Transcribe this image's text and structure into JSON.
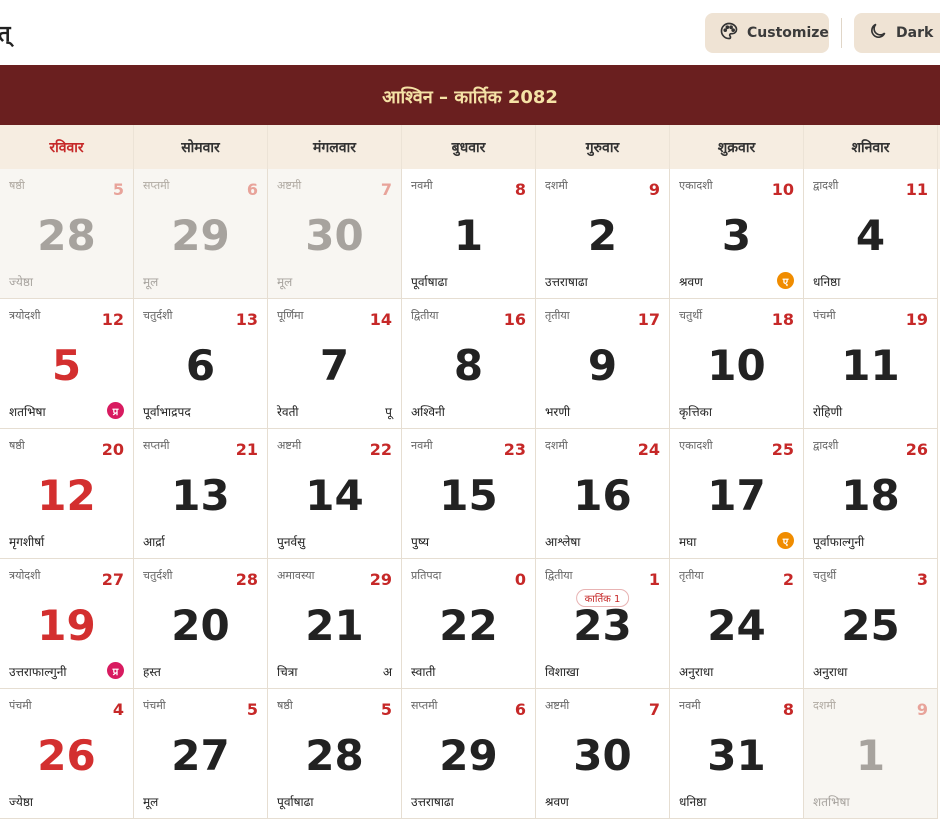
{
  "header": {
    "left_title_fragment": "त्",
    "customize_label": "Customize",
    "dark_label": "Dark",
    "customize_icon": "palette-icon",
    "dark_icon": "moon-icon"
  },
  "banner": {
    "month": "आश्विन – कार्तिक 2082"
  },
  "weekdays": [
    "रविवार",
    "सोमवार",
    "मंगलवार",
    "बुधवार",
    "गुरुवार",
    "शुक्रवार",
    "शनिवार"
  ],
  "colors": {
    "banner": "#6a1f1f",
    "banner_text": "#f5e2a6",
    "accent_red": "#c62828",
    "badge_orange": "#f08c00",
    "badge_pink": "#d81b60"
  },
  "days": [
    {
      "tithi": "षष्ठी",
      "eng": "5",
      "big": "28",
      "nak": "ज्येष्ठा",
      "other": true
    },
    {
      "tithi": "सप्तमी",
      "eng": "6",
      "big": "29",
      "nak": "मूल",
      "other": true
    },
    {
      "tithi": "अष्टमी",
      "eng": "7",
      "big": "30",
      "nak": "मूल",
      "other": true
    },
    {
      "tithi": "नवमी",
      "eng": "8",
      "big": "1",
      "nak": "पूर्वाषाढा"
    },
    {
      "tithi": "दशमी",
      "eng": "9",
      "big": "2",
      "nak": "उत्तराषाढा"
    },
    {
      "tithi": "एकादशी",
      "eng": "10",
      "big": "3",
      "nak": "श्रवण",
      "badge": "ए",
      "badge_color": "orange"
    },
    {
      "tithi": "द्वादशी",
      "eng": "11",
      "big": "4",
      "nak": "धनिष्ठा"
    },
    {
      "tithi": "त्रयोदशी",
      "eng": "12",
      "big": "5",
      "nak": "शतभिषा",
      "badge": "प्र",
      "badge_color": "pink"
    },
    {
      "tithi": "चतुर्दशी",
      "eng": "13",
      "big": "6",
      "nak": "पूर्वाभाद्रपद"
    },
    {
      "tithi": "पूर्णिमा",
      "eng": "14",
      "big": "7",
      "nak": "रेवती",
      "tag": "पू"
    },
    {
      "tithi": "द्वितीया",
      "eng": "16",
      "big": "8",
      "nak": "अश्विनी"
    },
    {
      "tithi": "तृतीया",
      "eng": "17",
      "big": "9",
      "nak": "भरणी"
    },
    {
      "tithi": "चतुर्थी",
      "eng": "18",
      "big": "10",
      "nak": "कृत्तिका"
    },
    {
      "tithi": "पंचमी",
      "eng": "19",
      "big": "11",
      "nak": "रोहिणी"
    },
    {
      "tithi": "षष्ठी",
      "eng": "20",
      "big": "12",
      "nak": "मृगशीर्षा"
    },
    {
      "tithi": "सप्तमी",
      "eng": "21",
      "big": "13",
      "nak": "आर्द्रा"
    },
    {
      "tithi": "अष्टमी",
      "eng": "22",
      "big": "14",
      "nak": "पुनर्वसु"
    },
    {
      "tithi": "नवमी",
      "eng": "23",
      "big": "15",
      "nak": "पुष्य"
    },
    {
      "tithi": "दशमी",
      "eng": "24",
      "big": "16",
      "nak": "आश्लेषा"
    },
    {
      "tithi": "एकादशी",
      "eng": "25",
      "big": "17",
      "nak": "मघा",
      "badge": "ए",
      "badge_color": "orange"
    },
    {
      "tithi": "द्वादशी",
      "eng": "26",
      "big": "18",
      "nak": "पूर्वाफाल्गुनी"
    },
    {
      "tithi": "त्रयोदशी",
      "eng": "27",
      "big": "19",
      "nak": "उत्तराफाल्गुनी",
      "badge": "प्र",
      "badge_color": "pink"
    },
    {
      "tithi": "चतुर्दशी",
      "eng": "28",
      "big": "20",
      "nak": "हस्त"
    },
    {
      "tithi": "अमावस्या",
      "eng": "29",
      "big": "21",
      "nak": "चित्रा",
      "tag": "अ"
    },
    {
      "tithi": "प्रतिपदा",
      "eng": "0",
      "big": "22",
      "nak": "स्वाती"
    },
    {
      "tithi": "द्वितीया",
      "eng": "1",
      "big": "23",
      "nak": "विशाखा",
      "pill": "कार्तिक 1"
    },
    {
      "tithi": "तृतीया",
      "eng": "2",
      "big": "24",
      "nak": "अनुराधा"
    },
    {
      "tithi": "चतुर्थी",
      "eng": "3",
      "big": "25",
      "nak": "अनुराधा"
    },
    {
      "tithi": "पंचमी",
      "eng": "4",
      "big": "26",
      "nak": "ज्येष्ठा"
    },
    {
      "tithi": "पंचमी",
      "eng": "5",
      "big": "27",
      "nak": "मूल"
    },
    {
      "tithi": "षष्ठी",
      "eng": "5",
      "big": "28",
      "nak": "पूर्वाषाढा"
    },
    {
      "tithi": "सप्तमी",
      "eng": "6",
      "big": "29",
      "nak": "उत्तराषाढा"
    },
    {
      "tithi": "अष्टमी",
      "eng": "7",
      "big": "30",
      "nak": "श्रवण"
    },
    {
      "tithi": "नवमी",
      "eng": "8",
      "big": "31",
      "nak": "धनिष्ठा"
    },
    {
      "tithi": "दशमी",
      "eng": "9",
      "big": "1",
      "nak": "शतभिषा",
      "other": true
    }
  ]
}
